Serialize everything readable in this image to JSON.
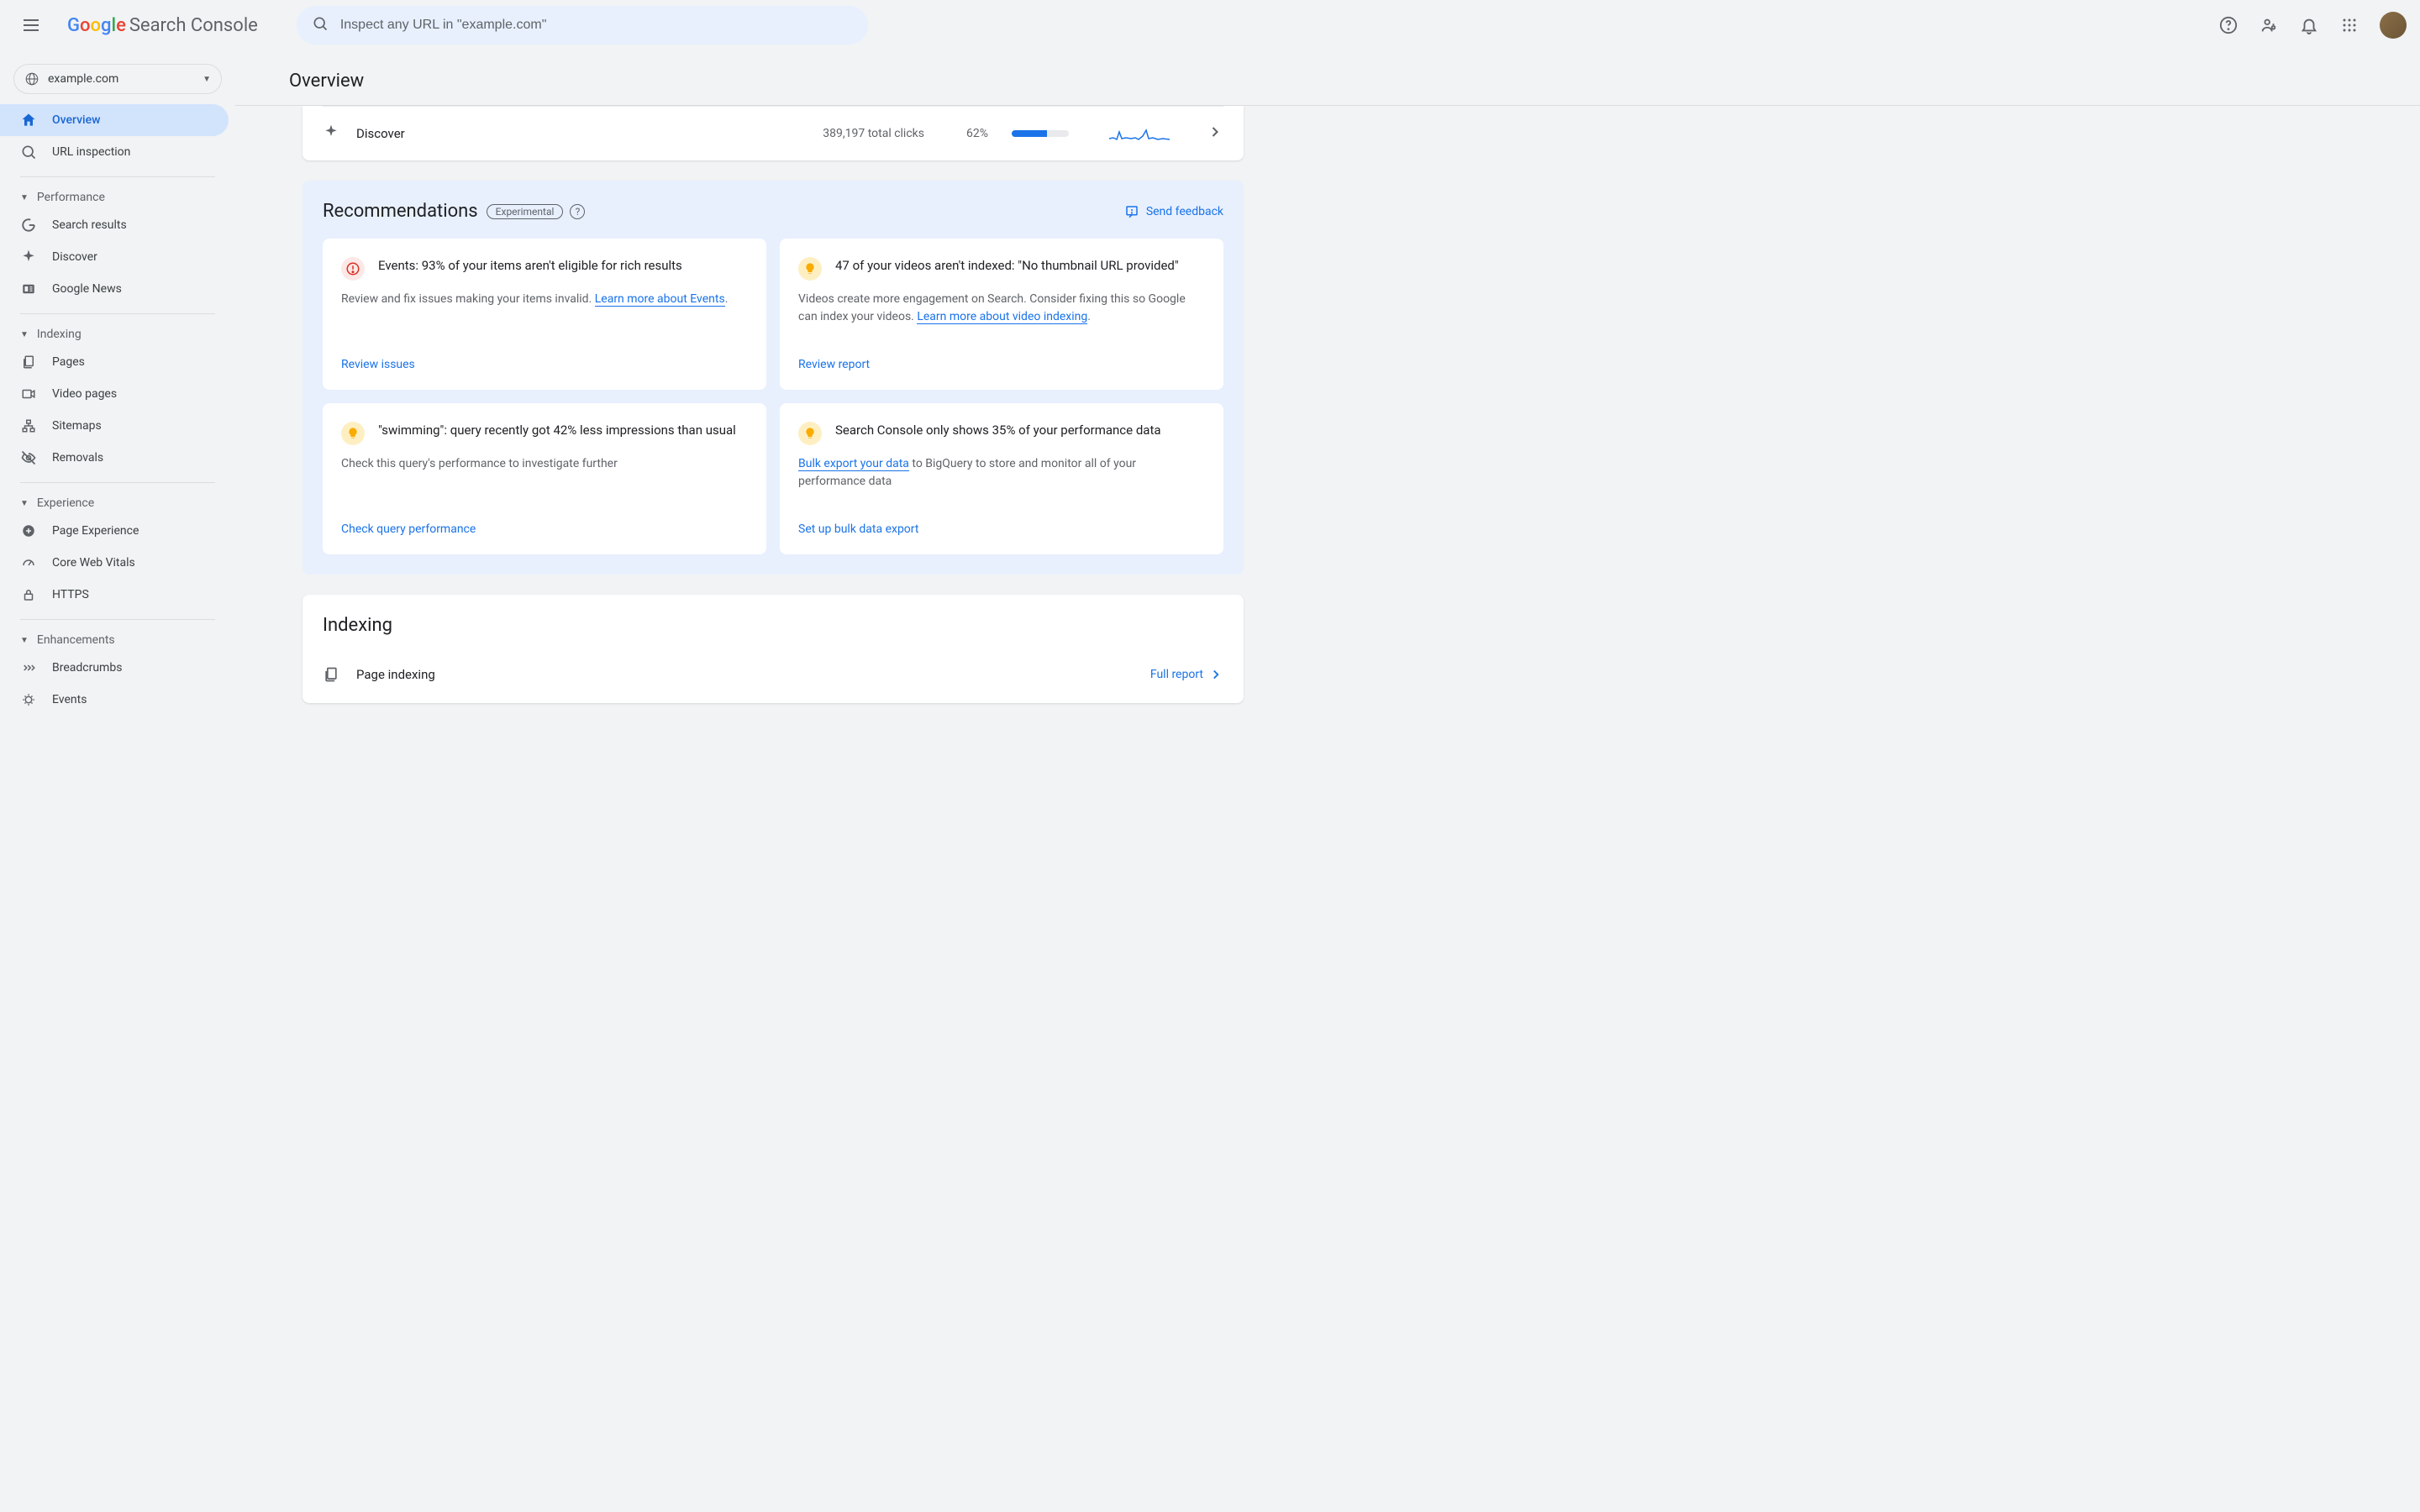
{
  "header": {
    "logo_google": "Google",
    "logo_sc": "Search Console",
    "search_placeholder": "Inspect any URL in \"example.com\""
  },
  "property": {
    "name": "example.com"
  },
  "page": {
    "title": "Overview"
  },
  "sidebar": {
    "items_top": [
      {
        "label": "Overview"
      },
      {
        "label": "URL inspection"
      }
    ],
    "section_performance": "Performance",
    "items_performance": [
      {
        "label": "Search results"
      },
      {
        "label": "Discover"
      },
      {
        "label": "Google News"
      }
    ],
    "section_indexing": "Indexing",
    "items_indexing": [
      {
        "label": "Pages"
      },
      {
        "label": "Video pages"
      },
      {
        "label": "Sitemaps"
      },
      {
        "label": "Removals"
      }
    ],
    "section_experience": "Experience",
    "items_experience": [
      {
        "label": "Page Experience"
      },
      {
        "label": "Core Web Vitals"
      },
      {
        "label": "HTTPS"
      }
    ],
    "section_enhancements": "Enhancements",
    "items_enhancements": [
      {
        "label": "Breadcrumbs"
      },
      {
        "label": "Events"
      }
    ]
  },
  "discover": {
    "label": "Discover",
    "clicks": "389,197 total clicks",
    "pct": "62%"
  },
  "recommendations": {
    "title": "Recommendations",
    "badge": "Experimental",
    "feedback": "Send feedback",
    "cards": [
      {
        "title": "Events: 93% of your items aren't eligible for rich results",
        "body": "Review and fix issues making your items invalid. ",
        "link": "Learn more about Events",
        "tail": ".",
        "action": "Review issues",
        "icon": "red",
        "glyph": "!"
      },
      {
        "title": "47 of your videos aren't indexed: \"No thumbnail URL provided\"",
        "body": "Videos create more engagement on Search. Consider fixing this so Google can index your videos. ",
        "link": "Learn more about video indexing",
        "tail": ".",
        "action": "Review report",
        "icon": "yellow",
        "glyph": "💡"
      },
      {
        "title": "\"swimming\": query recently got 42% less impressions than usual",
        "body": "Check this query's performance to investigate further",
        "link": "",
        "tail": "",
        "action": "Check query performance",
        "icon": "yellow",
        "glyph": "💡"
      },
      {
        "title": "Search Console only shows 35% of your performance data",
        "body": "",
        "prelink": "Bulk export your data",
        "posttext": " to BigQuery to store and monitor all of your performance data",
        "action": "Set up bulk data export",
        "icon": "yellow",
        "glyph": "💡"
      }
    ]
  },
  "indexing": {
    "title": "Indexing",
    "row_label": "Page indexing",
    "full_report": "Full report"
  },
  "colors": {
    "blue": "#1a73e8",
    "bg_blue": "#e8f0fe"
  }
}
